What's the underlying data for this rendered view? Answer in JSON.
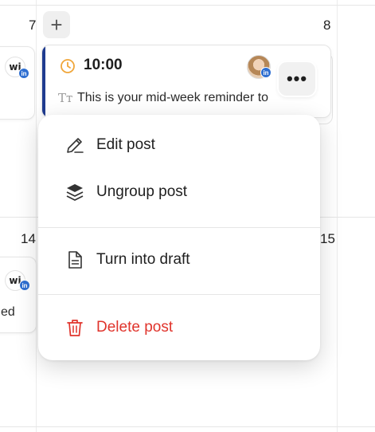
{
  "calendar": {
    "day_numbers": {
      "d7": "7",
      "d8": "8",
      "d14": "14",
      "d15": "15"
    },
    "add_button_label": "+"
  },
  "left_cards": {
    "top_brand": "wi",
    "bottom_brand": "wi",
    "bottom_text_fragment": "ed",
    "network_badge": "in"
  },
  "post_card": {
    "time": "10:00",
    "text_icon": "Tт",
    "text": "This is your mid-week reminder to",
    "network_badge": "in",
    "more_label": "•••",
    "accent_color": "#1f3b8f",
    "clock_color": "#f0a63a"
  },
  "menu": {
    "items": [
      {
        "label": "Edit post",
        "icon": "pencil-icon"
      },
      {
        "label": "Ungroup post",
        "icon": "layers-icon"
      },
      {
        "label": "Turn into draft",
        "icon": "document-icon"
      },
      {
        "label": "Delete post",
        "icon": "trash-icon",
        "color": "#e0342c"
      }
    ]
  }
}
